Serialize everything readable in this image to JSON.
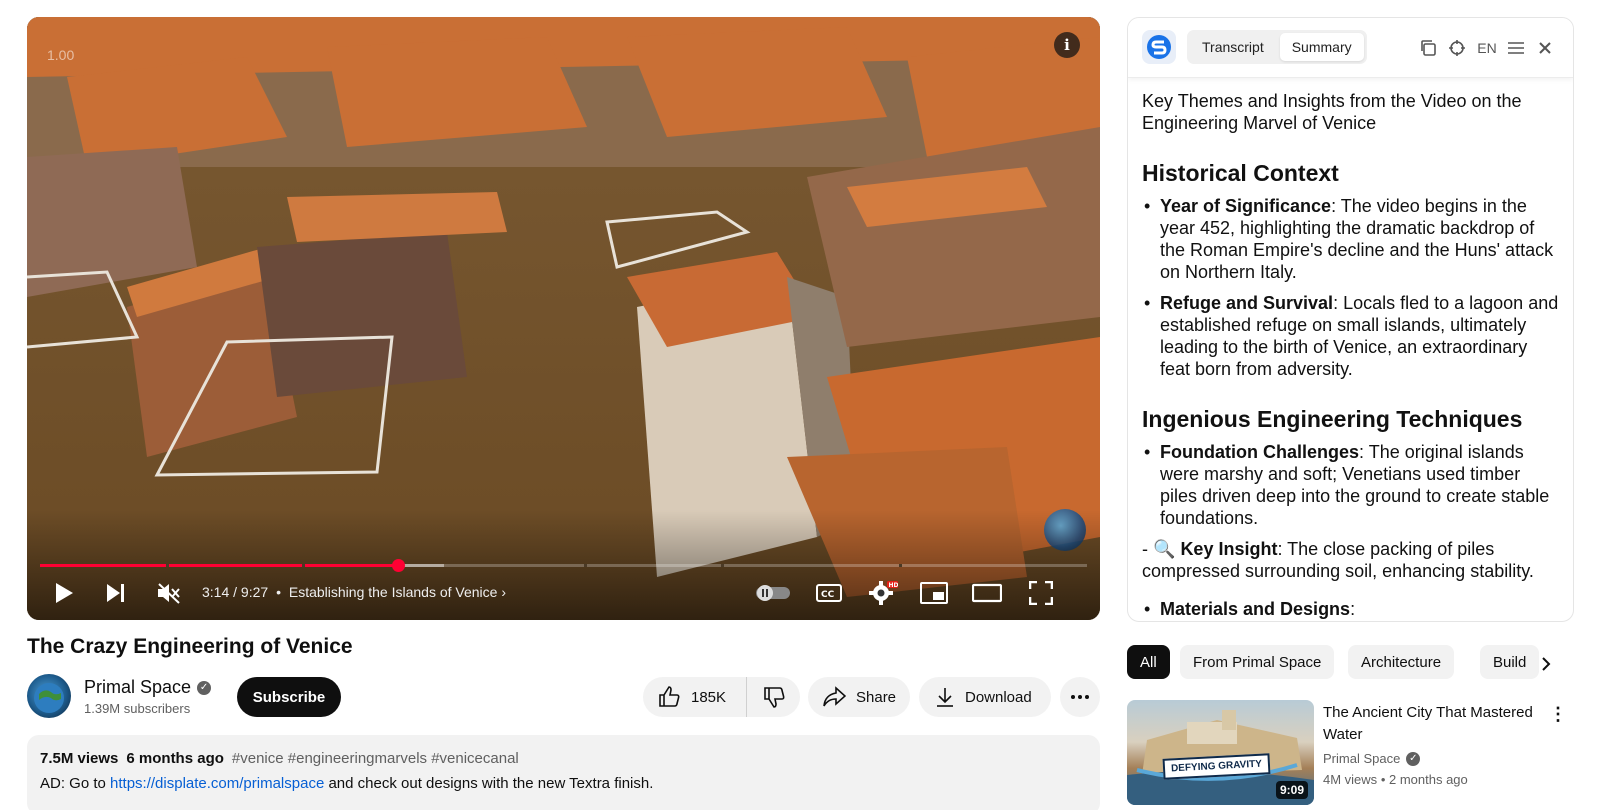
{
  "player": {
    "speed_label": "1.00",
    "info_glyph": "i",
    "current_time": "3:14",
    "duration": "9:27",
    "chapter": "Establishing the Islands of Venice",
    "progress_fraction": 0.342,
    "buffered_fraction": 0.386,
    "settings_badge": "HD"
  },
  "video": {
    "title": "The Crazy Engineering of Venice",
    "channel_name": "Primal Space",
    "subscribers": "1.39M subscribers",
    "subscribe_label": "Subscribe",
    "like_count": "185K",
    "share_label": "Share",
    "download_label": "Download"
  },
  "description": {
    "views": "7.5M views",
    "age": "6 months ago",
    "tags": "#venice #engineeringmarvels #venicecanal",
    "line_prefix": "AD: Go to",
    "link_text": "https://displate.com/primalspace",
    "line_suffix": "and check out designs with the new Textra finish."
  },
  "panel": {
    "tabs": [
      "Transcript",
      "Summary"
    ],
    "active_tab": "Summary",
    "lang_label": "EN",
    "intro": "Key Themes and Insights from the Video on the Engineering Marvel of Venice",
    "sections": [
      {
        "title": "Historical Context",
        "bullets": [
          {
            "term": "Year of Significance",
            "text": ": The video begins in the year 452, highlighting the dramatic backdrop of the Roman Empire's decline and the Huns' attack on Northern Italy."
          },
          {
            "term": "Refuge and Survival",
            "text": ": Locals fled to a lagoon and established refuge on small islands, ultimately leading to the birth of Venice, an extraordinary feat born from adversity."
          }
        ]
      },
      {
        "title": "Ingenious Engineering Techniques",
        "bullets": [
          {
            "term": "Foundation Challenges",
            "text": ": The original islands were marshy and soft; Venetians used timber piles driven deep into the ground to create stable foundations."
          }
        ],
        "insight_prefix": "- 🔍",
        "insight_term": "Key Insight",
        "insight_text": ": The close packing of piles compressed surrounding soil, enhancing stability.",
        "trailing_term": "Materials and Designs",
        "trailing_text": ":"
      }
    ]
  },
  "chips": [
    "All",
    "From Primal Space",
    "Architecture",
    "Build"
  ],
  "related": {
    "title": "The Ancient City That Mastered Water",
    "channel": "Primal Space",
    "views": "4M views",
    "age": "2 months ago",
    "duration": "9:09",
    "thumb_text": "DEFYING GRAVITY"
  }
}
